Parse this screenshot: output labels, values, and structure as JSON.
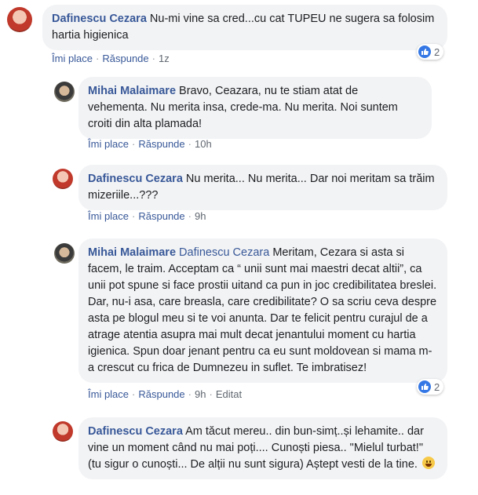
{
  "actions": {
    "like": "Îmi place",
    "reply": "Răspunde",
    "edited": "Editat"
  },
  "comments": [
    {
      "author": "Dafinescu Cezara",
      "text": "Nu-mi vine sa cred...cu cat TUPEU ne sugera sa folosim hartia higienica",
      "time": "1z",
      "reactions": "2"
    },
    {
      "author": "Mihai Malaimare",
      "text": "Bravo, Ceazara, nu te stiam atat de vehementa. Nu merita insa, crede-ma. Nu merita. Noi suntem croiti din alta plamada!",
      "time": "10h"
    },
    {
      "author": "Dafinescu Cezara",
      "text": "Nu merita... Nu merita... Dar noi meritam sa trăim mizeriile...???",
      "time": "9h"
    },
    {
      "author": "Mihai Malaimare",
      "mention": "Dafinescu Cezara",
      "text": "Meritam, Cezara si asta si facem, le traim. Acceptam ca “ unii sunt mai maestri decat altii”, ca unii pot spune si face prostii uitand ca pun in joc credibilitatea breslei. Dar, nu-i asa, care breasla, care credibilitate? O sa scriu ceva despre asta pe blogul meu si te voi anunta. Dar te felicit pentru curajul de a atrage atentia asupra mai mult decat jenantului moment cu hartia igienica. Spun doar jenant pentru ca eu sunt moldovean si mama m-a crescut cu frica de Dumnezeu in suflet. Te imbratisez!",
      "time": "9h",
      "reactions": "2"
    },
    {
      "author": "Dafinescu Cezara",
      "text": "Am tăcut mereu.. din bun-simț..și lehamite.. dar vine un moment când nu mai poți.... Cunoști piesa.. \"Mielul turbat!\" (tu sigur o cunoști... De alții nu sunt sigura) Aștept vesti de la tine.",
      "emoji": "grinning-face-emoji"
    }
  ]
}
